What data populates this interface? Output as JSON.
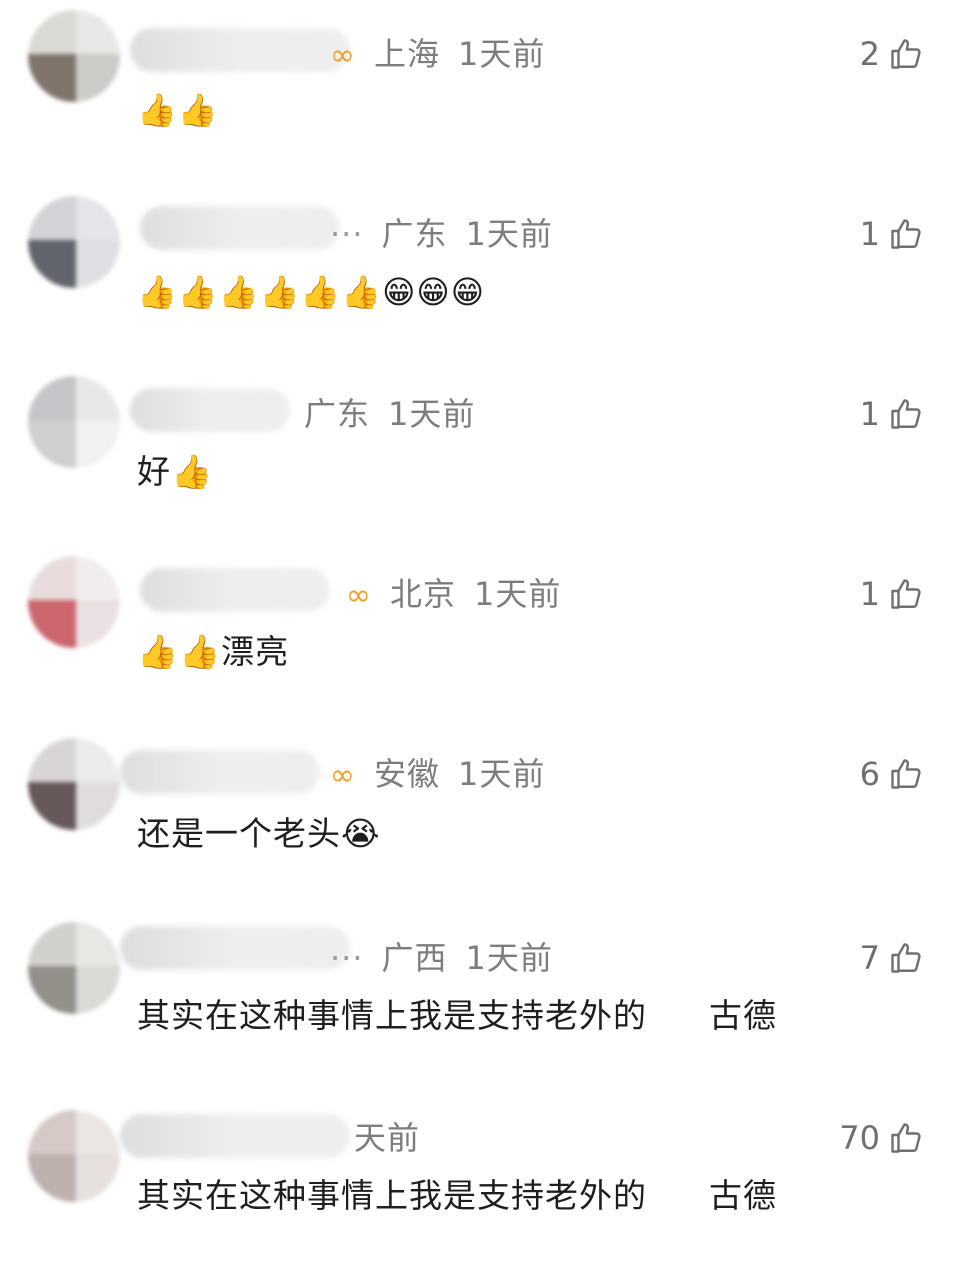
{
  "comments": [
    {
      "badge": "∞",
      "ellipsis": "",
      "location": "上海",
      "time": "1天前",
      "likes": "2",
      "body": "👍👍",
      "suffix": ""
    },
    {
      "badge": "",
      "ellipsis": "···",
      "location": "广东",
      "time": "1天前",
      "likes": "1",
      "body": "👍👍👍👍👍👍😁😁😁",
      "suffix": ""
    },
    {
      "badge": "",
      "ellipsis": "",
      "location": "广东",
      "time": "1天前",
      "likes": "1",
      "body": "好👍",
      "suffix": ""
    },
    {
      "badge": "∞",
      "ellipsis": "",
      "location": "北京",
      "time": "1天前",
      "likes": "1",
      "body": "👍👍漂亮",
      "suffix": ""
    },
    {
      "badge": "∞",
      "ellipsis": "",
      "location": "安徽",
      "time": "1天前",
      "likes": "6",
      "body": "还是一个老头😭",
      "suffix": ""
    },
    {
      "badge": "",
      "ellipsis": "···",
      "location": "广西",
      "time": "1天前",
      "likes": "7",
      "body": "其实在这种事情上我是支持老外的",
      "suffix": "古德"
    },
    {
      "badge": "",
      "ellipsis": "",
      "location": "",
      "time": "天前",
      "likes": "70",
      "body": "其实在这种事情上我是支持老外的",
      "suffix": "古德"
    }
  ],
  "colors": {
    "meta_text": "#7d7d7d",
    "body_text": "#1e1e1e",
    "badge": "#f0a022",
    "like_icon": "#6f6f6f"
  },
  "icons": {
    "like": "thumbs-up-outline-icon",
    "badge": "infinity-badge-icon"
  }
}
